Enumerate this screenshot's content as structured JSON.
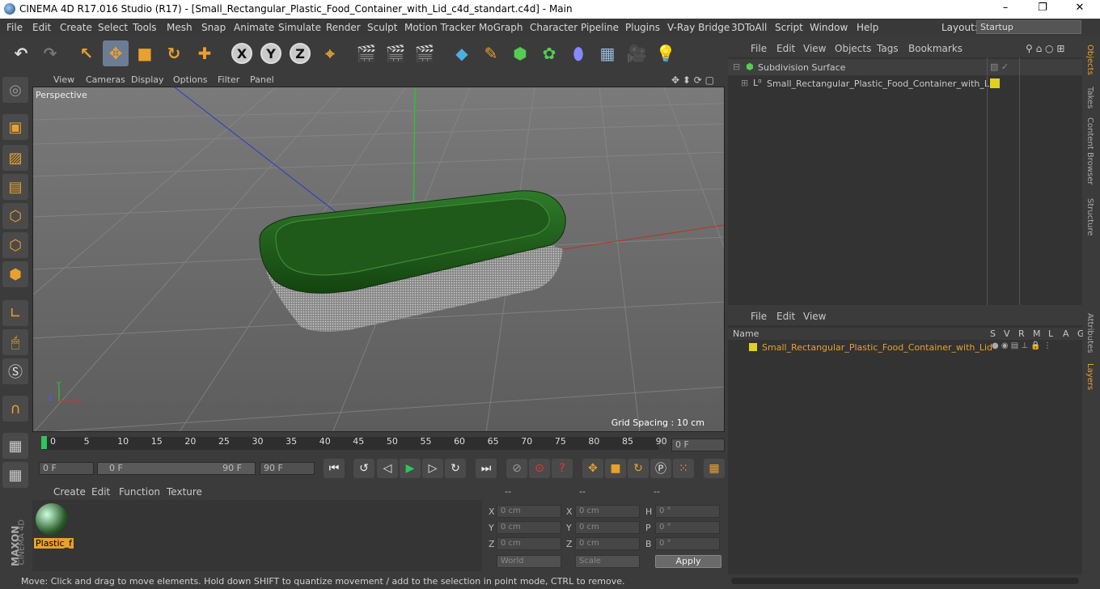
{
  "window": {
    "title": "CINEMA 4D R17.016 Studio (R17) - [Small_Rectangular_Plastic_Food_Container_with_Lid_c4d_standart.c4d] - Main",
    "minimize": "–",
    "maximize": "❐",
    "close": "✕"
  },
  "menu": [
    "File",
    "Edit",
    "Create",
    "Select",
    "Tools",
    "Mesh",
    "Snap",
    "Animate",
    "Simulate",
    "Render",
    "Sculpt",
    "Motion Tracker",
    "MoGraph",
    "Character",
    "Pipeline",
    "Plugins",
    "V-Ray Bridge",
    "3DToAll",
    "Script",
    "Window",
    "Help"
  ],
  "layout": {
    "label": "Layout:",
    "value": "Startup"
  },
  "toolbar": {
    "undo": "↶",
    "redo": "↷",
    "x": "X",
    "y": "Y",
    "z": "Z"
  },
  "viewport": {
    "menu": [
      "View",
      "Cameras",
      "Display",
      "Options",
      "Filter",
      "Panel"
    ],
    "camera": "Perspective",
    "grid_spacing": "Grid Spacing : 10 cm"
  },
  "timeline": {
    "ticks": [
      "0",
      "5",
      "10",
      "15",
      "20",
      "25",
      "30",
      "35",
      "40",
      "45",
      "50",
      "55",
      "60",
      "65",
      "70",
      "75",
      "80",
      "85",
      "90"
    ],
    "current": "0 F"
  },
  "transport": {
    "start": "0 F",
    "range_start": "0 F",
    "range_end": "90 F",
    "end": "90 F"
  },
  "material": {
    "menu": [
      "Create",
      "Edit",
      "Function",
      "Texture"
    ],
    "name": "Plastic_f"
  },
  "coords": {
    "headers": [
      "--",
      "--",
      "--"
    ],
    "pos": {
      "x": "0 cm",
      "y": "0 cm",
      "z": "0 cm"
    },
    "size": {
      "x": "0 cm",
      "y": "0 cm",
      "z": "0 cm"
    },
    "rot": {
      "h": "0 °",
      "p": "0 °",
      "b": "0 °"
    },
    "labels": {
      "x": "X",
      "y": "Y",
      "z": "Z",
      "h": "H",
      "p": "P",
      "b": "B"
    },
    "world": "World",
    "scale": "Scale",
    "apply": "Apply"
  },
  "status": "Move: Click and drag to move elements. Hold down SHIFT to quantize movement / add to the selection in point mode, CTRL to remove.",
  "objects": {
    "menu": [
      "File",
      "Edit",
      "View",
      "Objects",
      "Tags",
      "Bookmarks"
    ],
    "items": [
      "Subdivision Surface",
      "Small_Rectangular_Plastic_Food_Container_with_Lid"
    ]
  },
  "layers": {
    "menu": [
      "File",
      "Edit",
      "View"
    ],
    "col_name": "Name",
    "cols": [
      "S",
      "V",
      "R",
      "M",
      "L",
      "A",
      "G"
    ],
    "item": "Small_Rectangular_Plastic_Food_Container_with_Lid"
  },
  "sidetabs": [
    "Objects",
    "Takes",
    "Content Browser",
    "Structure",
    "Attributes",
    "Layers"
  ],
  "brand": {
    "maxon": "MAXON",
    "c4d": "CINEMA 4D"
  },
  "colors": {
    "accent": "#e8a030",
    "layer_yellow": "#e0d020",
    "lid_green": "#1f5a1a"
  }
}
